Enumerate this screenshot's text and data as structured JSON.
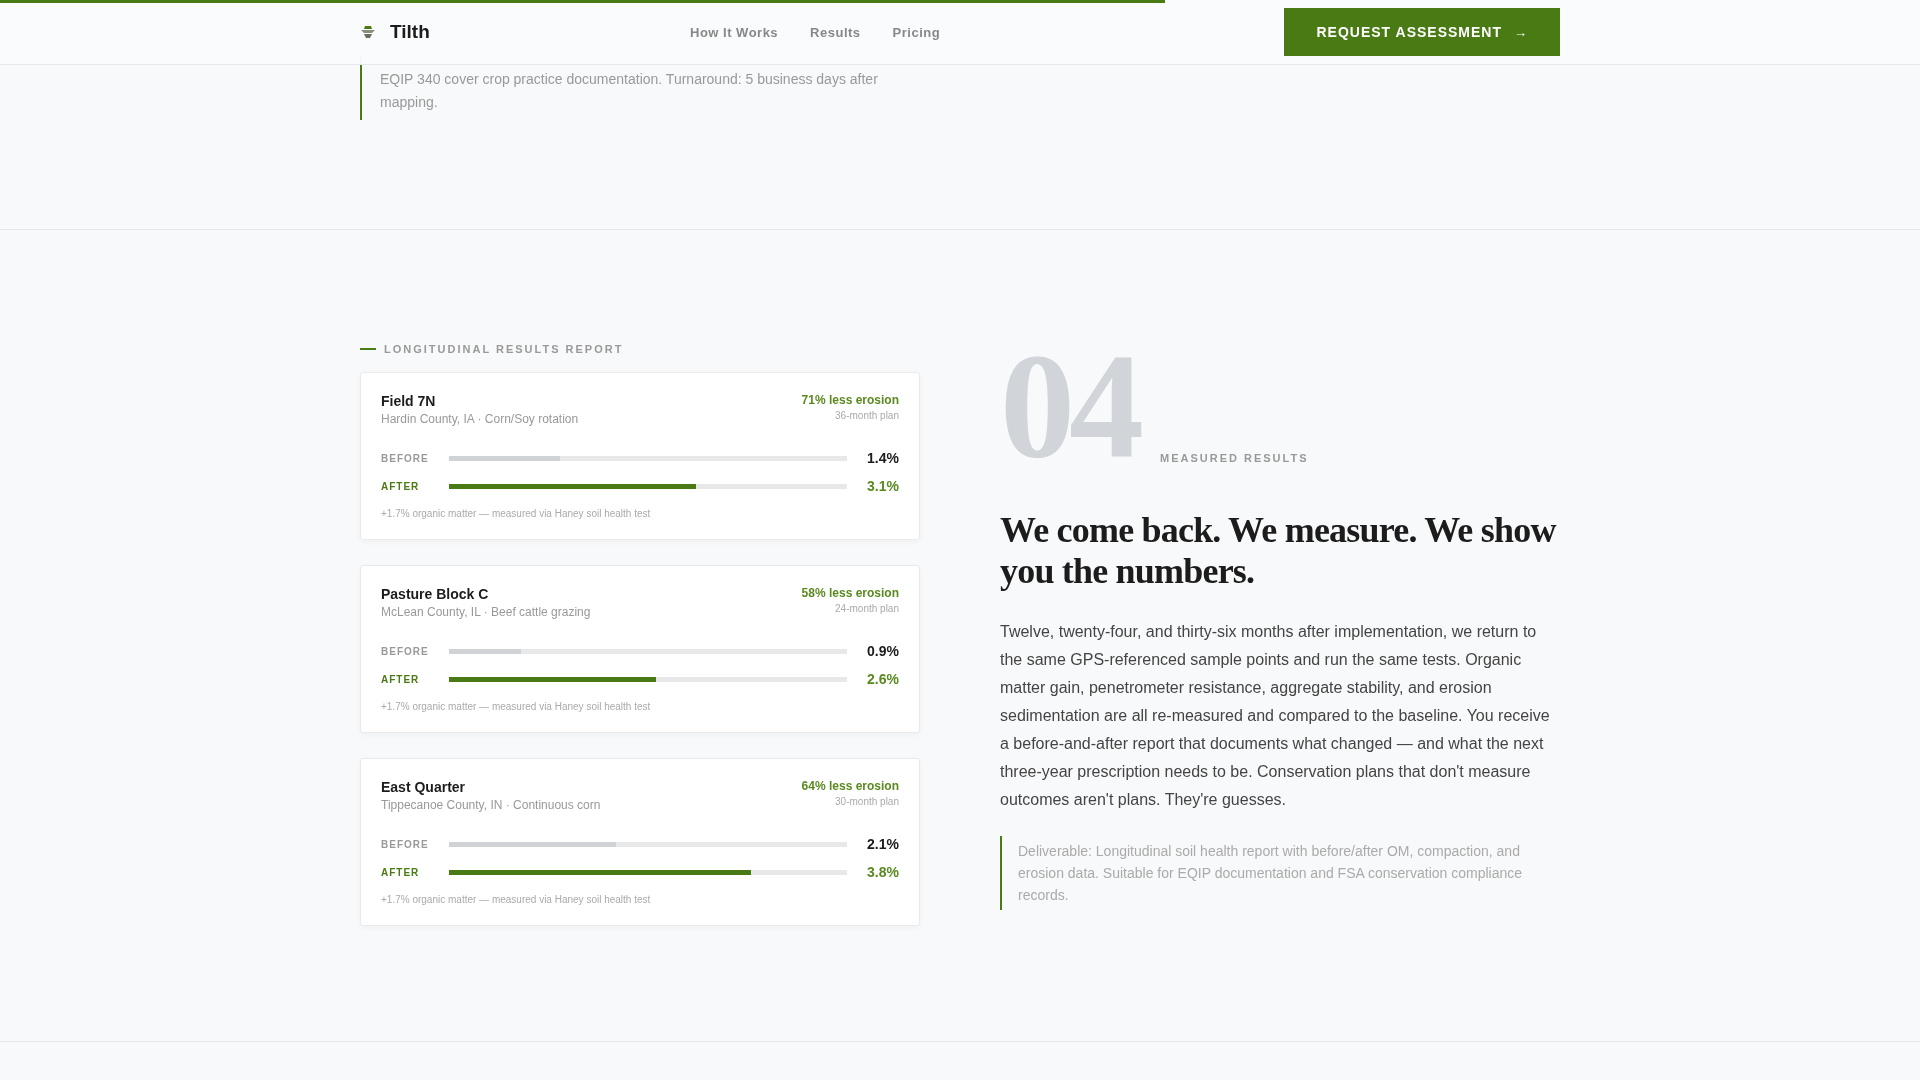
{
  "scroll_progress": {
    "level": 0.607
  },
  "header": {
    "brand": "Tilth",
    "nav": [
      "How It Works",
      "Results",
      "Pricing"
    ],
    "cta": "REQUEST ASSESSMENT",
    "cta_arrow": "→"
  },
  "previous_section": {
    "note": "EQIP 340 cover crop practice documentation. Turnaround: 5 business days after mapping."
  },
  "report": {
    "label": "LONGITUDINAL RESULTS REPORT",
    "fields": [
      {
        "name": "Field 7N",
        "location": "Hardin County, IA · Corn/Soy rotation",
        "result": "71% less erosion",
        "plan": "36-month plan",
        "rows": [
          {
            "kind": "before",
            "label": "BEFORE",
            "level": 0.28,
            "reading": "1.4%"
          },
          {
            "kind": "after",
            "label": "AFTER",
            "level": 0.62,
            "reading": "3.1%"
          }
        ],
        "footnote": "+1.7% organic matter — measured via Haney soil health test"
      },
      {
        "name": "Pasture Block C",
        "location": "McLean County, IL · Beef cattle grazing",
        "result": "58% less erosion",
        "plan": "24-month plan",
        "rows": [
          {
            "kind": "before",
            "label": "BEFORE",
            "level": 0.18,
            "reading": "0.9%"
          },
          {
            "kind": "after",
            "label": "AFTER",
            "level": 0.52,
            "reading": "2.6%"
          }
        ],
        "footnote": "+1.7% organic matter — measured via Haney soil health test"
      },
      {
        "name": "East Quarter",
        "location": "Tippecanoe County, IN · Continuous corn",
        "result": "64% less erosion",
        "plan": "30-month plan",
        "rows": [
          {
            "kind": "before",
            "label": "BEFORE",
            "level": 0.42,
            "reading": "2.1%"
          },
          {
            "kind": "after",
            "label": "AFTER",
            "level": 0.76,
            "reading": "3.8%"
          }
        ],
        "footnote": "+1.7% organic matter — measured via Haney soil health test"
      }
    ]
  },
  "results": {
    "number": "04",
    "eyebrow": "MEASURED RESULTS",
    "heading": "We come back. We measure. We show you the numbers.",
    "body": "Twelve, twenty-four, and thirty-six months after implementation, we return to the same GPS-referenced sample points and run the same tests. Organic matter gain, penetrometer resistance, aggregate stability, and erosion sedimentation are all re-measured and compared to the baseline. You receive a before-and-after report that documents what changed — and what the next three-year prescription needs to be. Conservation plans that don't measure outcomes aren't plans. They're guesses.",
    "deliverable": "Deliverable: Longitudinal soil health report with before/after OM, compaction, and erosion data. Suitable for EQIP documentation and FSA conservation compliance records."
  }
}
